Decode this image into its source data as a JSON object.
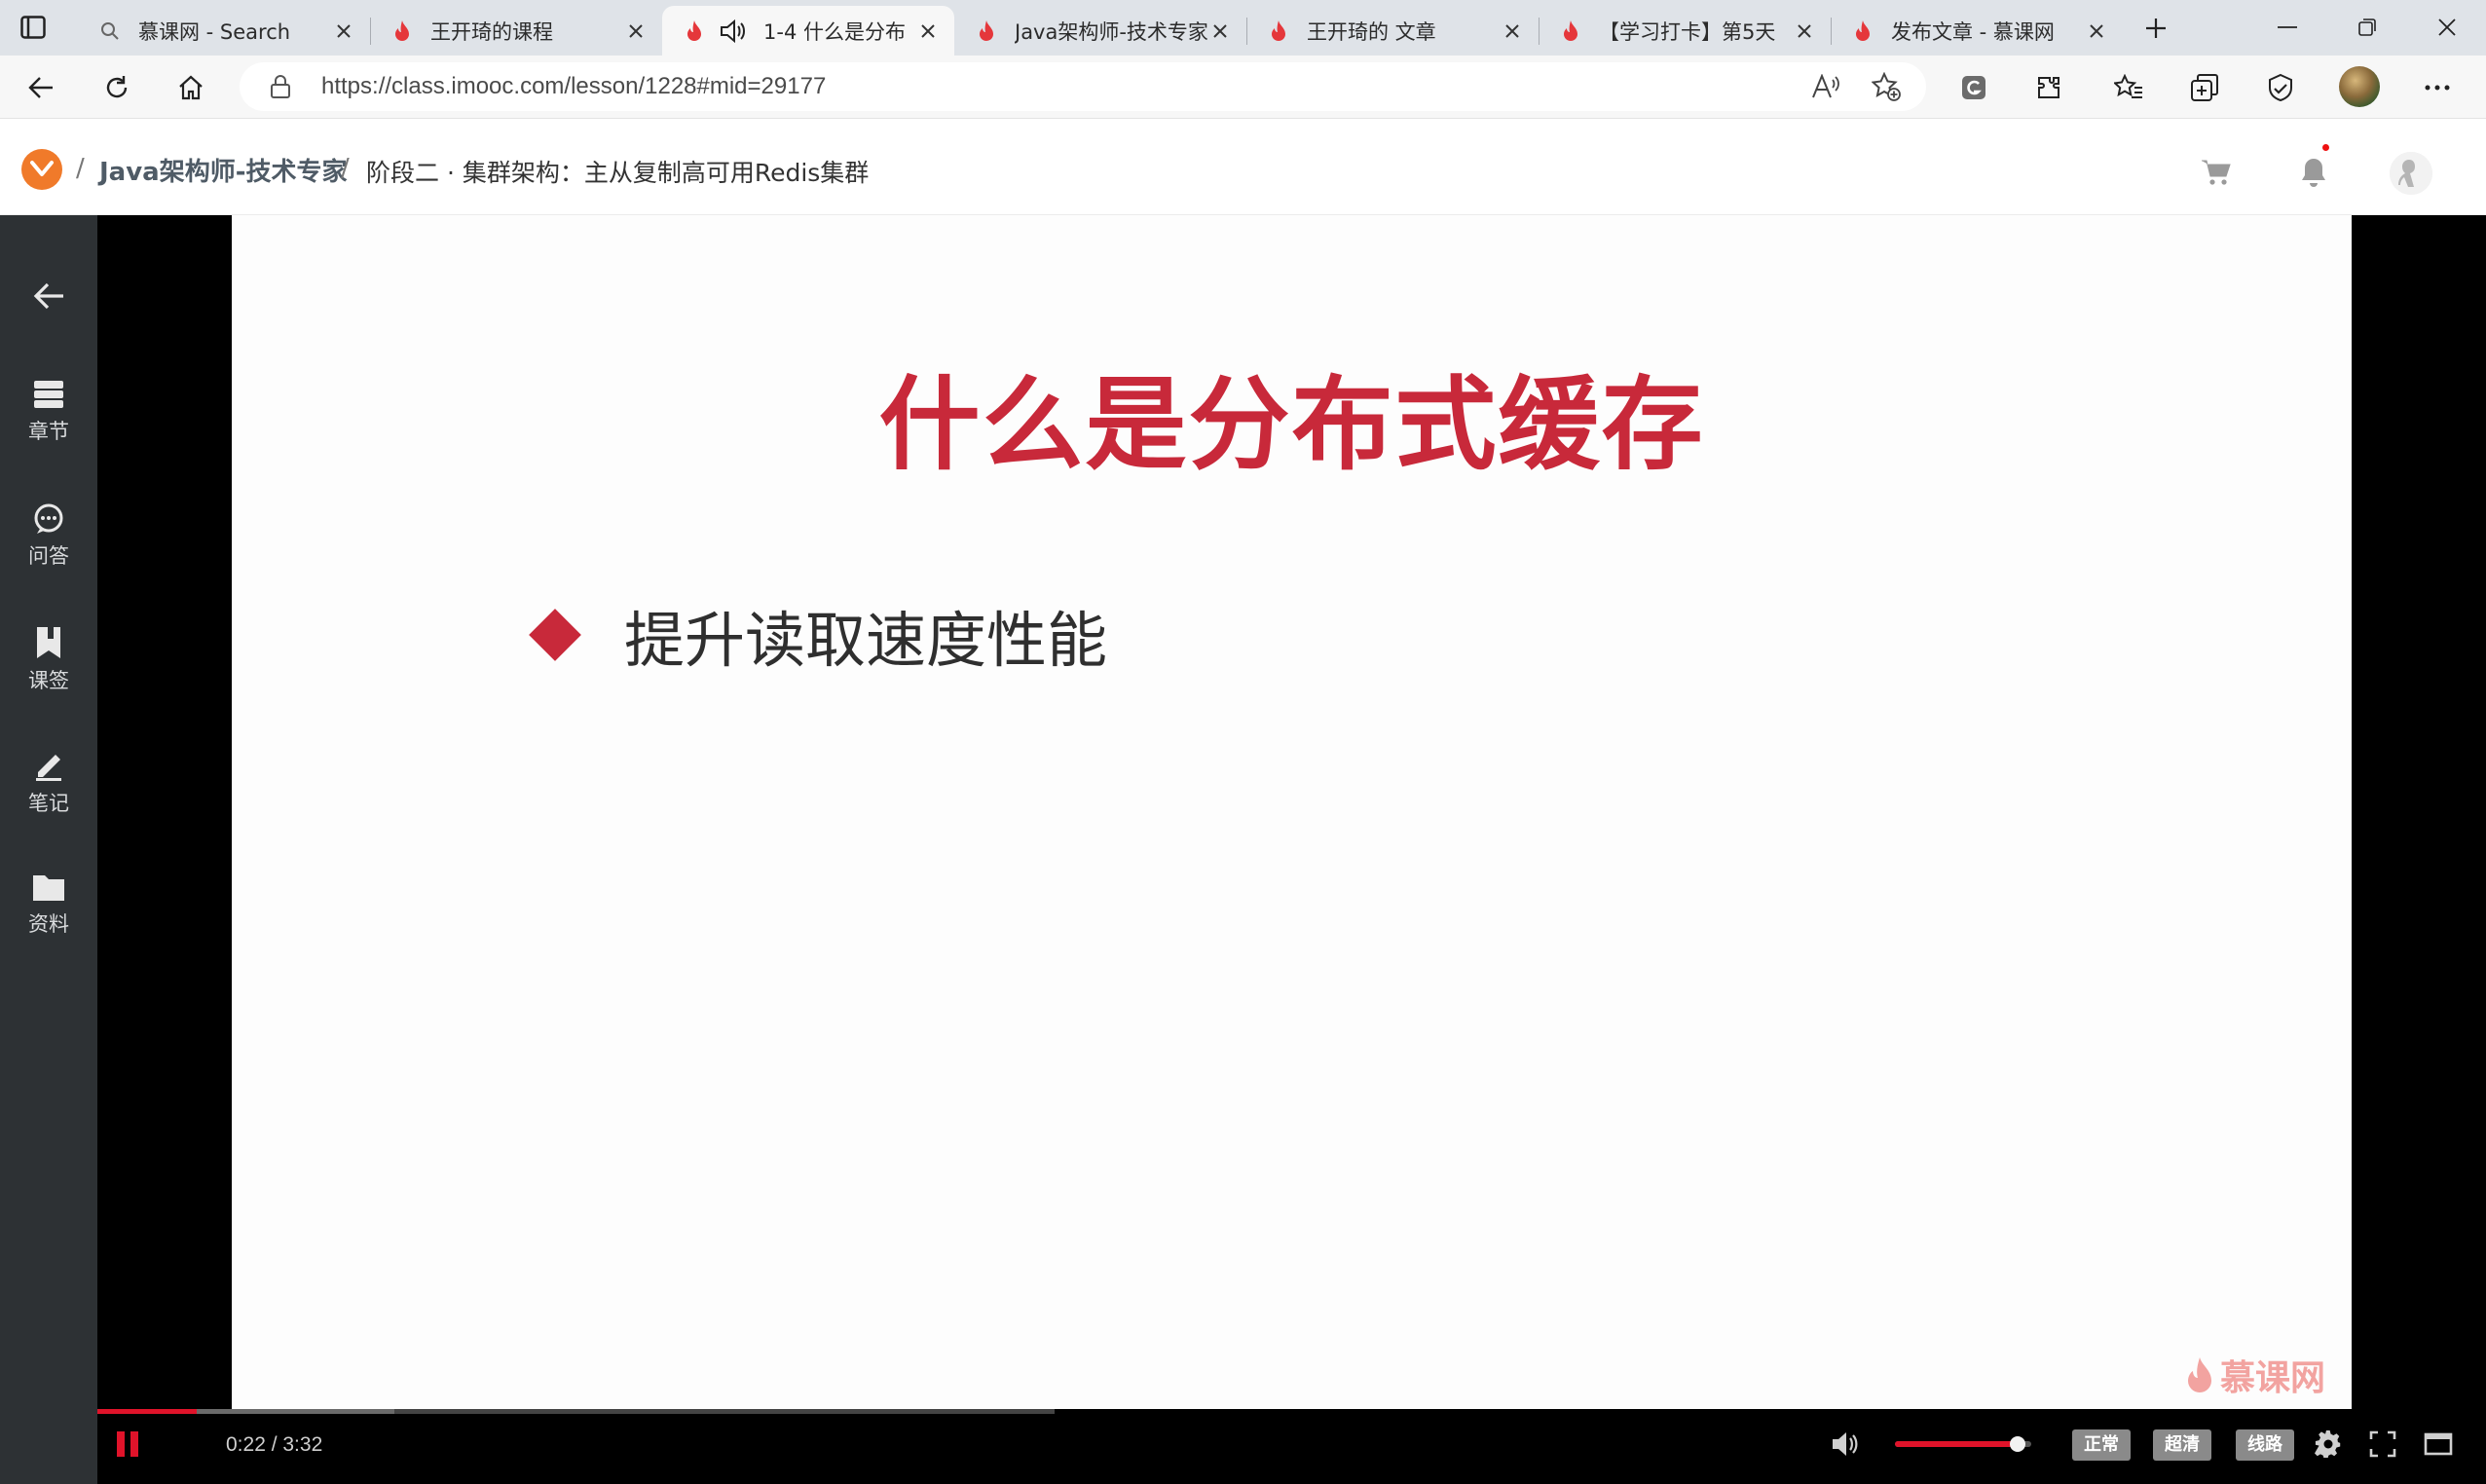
{
  "browser": {
    "tabs": [
      {
        "title": "慕课网 - Search",
        "favicon": "search-icon",
        "active": false
      },
      {
        "title": "王开琦的课程",
        "favicon": "imooc-flame-icon",
        "active": false
      },
      {
        "title": "1-4 什么是分布",
        "favicon": "imooc-flame-icon",
        "active": true,
        "audio": true
      },
      {
        "title": "Java架构师-技术专家",
        "favicon": "imooc-flame-icon",
        "active": false
      },
      {
        "title": "王开琦的 文章",
        "favicon": "imooc-flame-icon",
        "active": false
      },
      {
        "title": "【学习打卡】第5天",
        "favicon": "imooc-flame-icon",
        "active": false
      },
      {
        "title": "发布文章 - 慕课网",
        "favicon": "imooc-flame-icon",
        "active": false
      }
    ],
    "url": "https://class.imooc.com/lesson/1228#mid=29177"
  },
  "header": {
    "course": "Java架构师-技术专家",
    "lesson": "阶段二 · 集群架构：主从复制高可用Redis集群",
    "separator": "/"
  },
  "sidebar": {
    "items": [
      {
        "label": "",
        "icon": "back-arrow-icon"
      },
      {
        "label": "章节",
        "icon": "chapters-icon"
      },
      {
        "label": "问答",
        "icon": "qa-icon"
      },
      {
        "label": "课签",
        "icon": "bookmark-icon"
      },
      {
        "label": "笔记",
        "icon": "note-pen-icon"
      },
      {
        "label": "资料",
        "icon": "folder-icon"
      }
    ]
  },
  "slide": {
    "title": "什么是分布式缓存",
    "bullet": "提升读取速度性能",
    "watermark": "慕课网"
  },
  "player": {
    "time": "0:22 / 3:32",
    "progress_played": 0.104,
    "progress_buffered": 0.31,
    "volume": 0.9,
    "speed_label": "正常",
    "quality_label": "超清",
    "line_label": "线路"
  },
  "colors": {
    "accent_red": "#c8293a",
    "player_red": "#e0132a",
    "logo_orange": "#f07a2a",
    "rail_bg": "#2d3134"
  }
}
